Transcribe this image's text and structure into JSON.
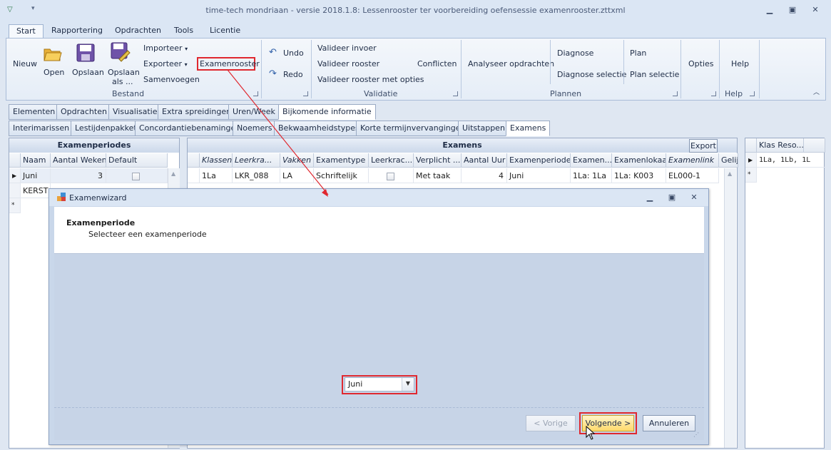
{
  "window": {
    "title": "time-tech mondriaan - versie 2018.1.8: Lessenrooster ter voorbereiding oefensessie examenrooster.zttxml"
  },
  "ribbon_tabs": [
    "Start",
    "Rapportering",
    "Opdrachten",
    "Tools",
    "Licentie"
  ],
  "ribbon": {
    "nieuw": "Nieuw",
    "open": "Open",
    "opslaan": "Opslaan",
    "opslaan_als_1": "Opslaan",
    "opslaan_als_2": "als ...",
    "importeer": "Importeer",
    "exporteer": "Exporteer",
    "samenvoegen": "Samenvoegen",
    "examenrooster": "Examenrooster",
    "bestand_label": "Bestand",
    "undo": "Undo",
    "redo": "Redo",
    "valideer_invoer": "Valideer invoer",
    "valideer_rooster": "Valideer rooster",
    "valideer_rooster_opties": "Valideer rooster met opties",
    "conflicten": "Conflicten",
    "validatie_label": "Validatie",
    "analyseer": "Analyseer opdrachten",
    "diagnose": "Diagnose",
    "diagnose_selectie": "Diagnose selectie",
    "plan": "Plan",
    "plan_selectie": "Plan selectie",
    "plannen_label": "Plannen",
    "opties": "Opties",
    "help": "Help",
    "help_label": "Help"
  },
  "tabs_row1": [
    "Elementen",
    "Opdrachten",
    "Visualisatie",
    "Extra spreidingen",
    "Uren/Week",
    "Bijkomende informatie"
  ],
  "tabs_row2": [
    "Interimarissen",
    "Lestijdenpakket",
    "Concordantiebenamingen",
    "Noemers",
    "Bekwaamheidstypes",
    "Korte termijnvervangingen",
    "Uitstappen",
    "Examens"
  ],
  "examenperiodes": {
    "title": "Examenperiodes",
    "columns": [
      "Naam",
      "Aantal Weken",
      "Default"
    ],
    "rows": [
      {
        "naam": "Juni",
        "weken": "3"
      },
      {
        "naam": "KERST",
        "weken": ""
      }
    ],
    "new_row_marker": "*"
  },
  "examens": {
    "title": "Examens",
    "export_label": "Export",
    "columns": [
      "Klassen",
      "Leerkra...",
      "Vakken",
      "Examentype",
      "Leerkrac...",
      "Verplicht ...",
      "Aantal Uur",
      "Examenperiodes",
      "Examen...",
      "Examenlokaal",
      "Examenlink",
      "Gelij"
    ],
    "row": [
      "1La",
      "LKR_088",
      "LA",
      "Schriftelijk",
      "",
      "Met taak",
      "4",
      "Juni",
      "1La: 1La",
      "1La: K003",
      "EL000-1"
    ]
  },
  "klas_panel": {
    "column": "Klas Reso...",
    "row": "1La, 1Lb, 1L",
    "new_row_marker": "*"
  },
  "wizard": {
    "title": "Examenwizard",
    "heading": "Examenperiode",
    "subheading": "Selecteer een examenperiode",
    "combo_value": "Juni",
    "back_label": "< Vorige",
    "next_label": "Volgende >",
    "cancel_label": "Annuleren"
  },
  "colors": {
    "highlight_red": "#e0282f",
    "ribbon_bg": "#dbe6f4"
  }
}
